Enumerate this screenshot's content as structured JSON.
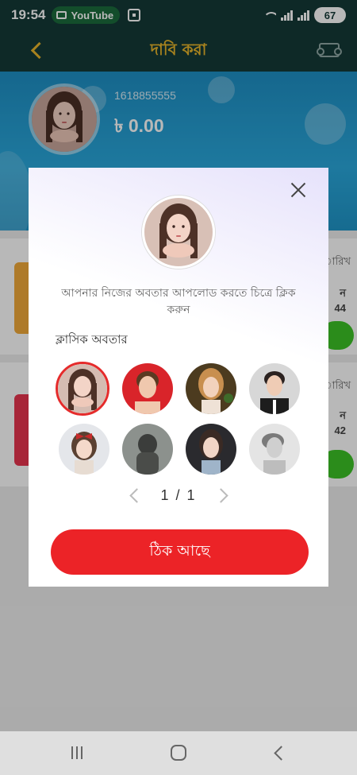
{
  "status_bar": {
    "time": "19:54",
    "youtube_label": "YouTube",
    "battery": "67"
  },
  "header": {
    "title": "দাবি করা"
  },
  "profile": {
    "phone": "1618855555",
    "balance": "৳ 0.00"
  },
  "background_cards": [
    {
      "date_label": "ারিখ",
      "label": "ন",
      "number": "44"
    },
    {
      "date_label": "ারিখ",
      "label": "ন",
      "number": "42"
    }
  ],
  "modal": {
    "hint": "আপনার নিজের অবতার আপলোড করতে চিত্রে ক্লিক করুন",
    "section_label": "ক্লাসিক অবতার",
    "avatars": [
      {
        "icon": "avatar-girl-hands-face",
        "selected": true
      },
      {
        "icon": "avatar-boy-red-background",
        "selected": false
      },
      {
        "icon": "avatar-girl-blonde",
        "selected": false
      },
      {
        "icon": "avatar-boy-dark-hair",
        "selected": false
      },
      {
        "icon": "avatar-girl-bow",
        "selected": false
      },
      {
        "icon": "avatar-hooded-figure",
        "selected": false
      },
      {
        "icon": "avatar-girl-dark-hair",
        "selected": false
      },
      {
        "icon": "avatar-boy-monochrome",
        "selected": false
      }
    ],
    "pager": "1 / 1",
    "ok_label": "ঠিক আছে"
  },
  "colors": {
    "header_bg": "#143a37",
    "header_accent": "#e8b52a",
    "ok_button": "#ec2327",
    "selected_ring": "#e52b2b",
    "go_button": "#3cc226"
  }
}
